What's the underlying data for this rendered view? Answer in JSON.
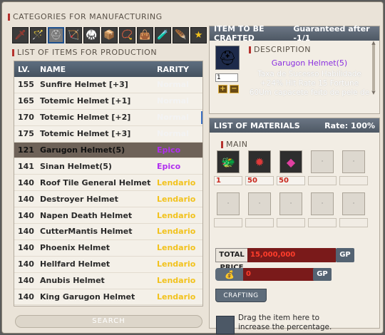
{
  "categories": {
    "title": "CATEGORIES FOR MANUFACTURING",
    "icons": [
      "sword-icon",
      "staff-icon",
      "helmet-icon",
      "crossbow-icon",
      "armor-icon",
      "box-icon",
      "necklace-icon",
      "bag-icon",
      "potion-icon",
      "wings-icon",
      "star-icon"
    ],
    "glyphs": [
      "🗡",
      "🪄",
      "⛑",
      "🏹",
      "🥋",
      "📦",
      "📿",
      "👜",
      "🧪",
      "🪶",
      "★"
    ],
    "colors": [
      "#e03a2a",
      "#d8453a",
      "#c8c8c8",
      "#d8b04a",
      "#e0a040",
      "#c87a3a",
      "#d8d040",
      "#c05a2a",
      "#c0e050",
      "#f0e060",
      "#f2c21c"
    ]
  },
  "list": {
    "title": "LIST OF ITEMS FOR PRODUCTION",
    "headers": {
      "lv": "LV.",
      "name": "NAME",
      "rarity": "RARITY"
    },
    "rows": [
      {
        "lv": "155",
        "name": "Sunfire Helmet [+3]",
        "rarity": "Normal",
        "rclass": "rar-normal"
      },
      {
        "lv": "165",
        "name": "Totemic Helmet [+1]",
        "rarity": "Normal",
        "rclass": "rar-normal"
      },
      {
        "lv": "170",
        "name": "Totemic Helmet [+2]",
        "rarity": "Normal",
        "rclass": "rar-normal"
      },
      {
        "lv": "175",
        "name": "Totemic Helmet [+3]",
        "rarity": "Normal",
        "rclass": "rar-normal"
      },
      {
        "lv": "121",
        "name": "Garugon Helmet(5)",
        "rarity": "Epico",
        "rclass": "rar-epico",
        "selected": true
      },
      {
        "lv": "141",
        "name": "Sinan Helmet(5)",
        "rarity": "Epico",
        "rclass": "rar-epico"
      },
      {
        "lv": "140",
        "name": "Roof Tile General Helmet",
        "rarity": "Lendario",
        "rclass": "rar-lend"
      },
      {
        "lv": "140",
        "name": "Destroyer Helmet",
        "rarity": "Lendario",
        "rclass": "rar-lend"
      },
      {
        "lv": "140",
        "name": "Napen Death Helmet",
        "rarity": "Lendario",
        "rclass": "rar-lend"
      },
      {
        "lv": "140",
        "name": "CutterMantis Helmet",
        "rarity": "Lendario",
        "rclass": "rar-lend"
      },
      {
        "lv": "140",
        "name": "Phoenix Helmet",
        "rarity": "Lendario",
        "rclass": "rar-lend"
      },
      {
        "lv": "140",
        "name": "Hellfard Helmet",
        "rarity": "Lendario",
        "rclass": "rar-lend"
      },
      {
        "lv": "140",
        "name": "Anubis Helmet",
        "rarity": "Lendario",
        "rclass": "rar-lend"
      },
      {
        "lv": "140",
        "name": "King Garugon Helmet",
        "rarity": "Lendario",
        "rclass": "rar-lend"
      }
    ],
    "search_label": "SEARCH"
  },
  "crafted": {
    "title": "ITEM TO BE CRAFTED",
    "guarantee": "Guaranteed after -1/1",
    "quantity": "1",
    "plus": "+",
    "minus": "−",
    "desc_title": "DESCRIPTION",
    "item_name": "Garugon Helmet(5)",
    "desc_text": "Taxa de Sucesso Habilidade +24% Hit Rate 15 Fortune 60Um capacete feito de pele de"
  },
  "materials": {
    "title": "LIST OF MATERIALS",
    "rate": "Rate: 100%",
    "main_label": "MAIN",
    "items": [
      {
        "icon": "creature-icon",
        "glyph": "🐲",
        "count": "1"
      },
      {
        "icon": "red-crystal-icon",
        "glyph": "✹",
        "count": "50"
      },
      {
        "icon": "pink-gem-icon",
        "glyph": "◆",
        "count": "50"
      }
    ],
    "total_label": "TOTAL PRICE",
    "total_value": "15,000,000",
    "gp": "GP",
    "gp_input": "0",
    "craft_label": "CRAFTING",
    "drop_text": "Drag the item here to increase the percentage."
  }
}
